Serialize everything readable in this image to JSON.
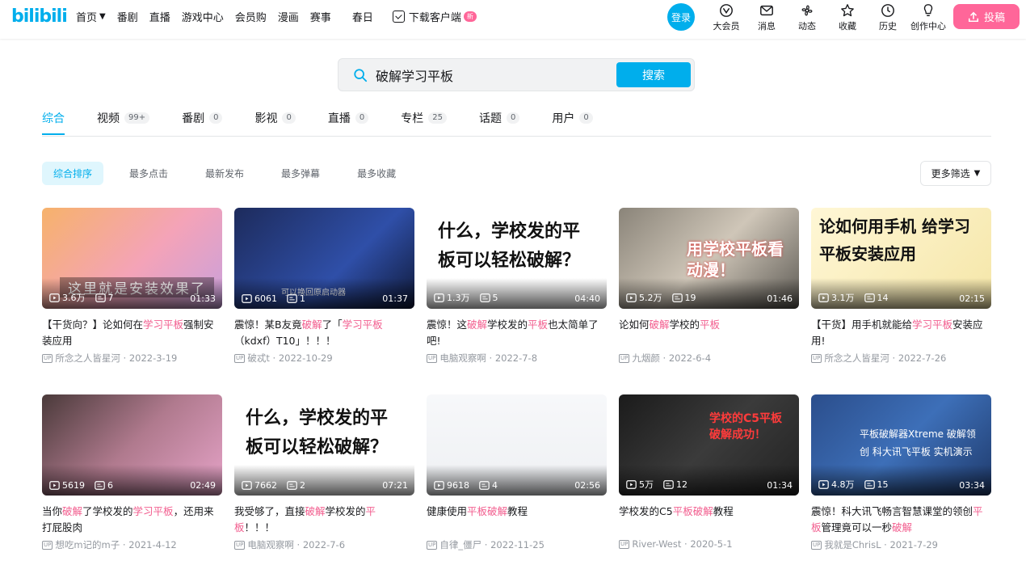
{
  "header": {
    "logo": "bilibili",
    "nav": [
      {
        "label": "首页",
        "chevron": true
      },
      {
        "label": "番剧"
      },
      {
        "label": "直播"
      },
      {
        "label": "游戏中心"
      },
      {
        "label": "会员购"
      },
      {
        "label": "漫画"
      },
      {
        "label": "赛事"
      },
      {
        "label": "春日"
      }
    ],
    "download": {
      "label": "下载客户端",
      "badge": "新"
    },
    "login": "登录",
    "right_items": [
      {
        "label": "大会员",
        "icon": "vip-icon"
      },
      {
        "label": "消息",
        "icon": "message-icon"
      },
      {
        "label": "动态",
        "icon": "dynamic-icon"
      },
      {
        "label": "收藏",
        "icon": "favorite-icon"
      },
      {
        "label": "历史",
        "icon": "history-icon"
      },
      {
        "label": "创作中心",
        "icon": "creator-icon"
      }
    ],
    "upload": "投稿"
  },
  "search": {
    "value": "破解学习平板",
    "button": "搜索"
  },
  "tabs": [
    {
      "label": "综合",
      "count": ""
    },
    {
      "label": "视频",
      "count": "99+"
    },
    {
      "label": "番剧",
      "count": "0"
    },
    {
      "label": "影视",
      "count": "0"
    },
    {
      "label": "直播",
      "count": "0"
    },
    {
      "label": "专栏",
      "count": "25"
    },
    {
      "label": "话题",
      "count": "0"
    },
    {
      "label": "用户",
      "count": "0"
    }
  ],
  "sorts": [
    "综合排序",
    "最多点击",
    "最新发布",
    "最多弹幕",
    "最多收藏"
  ],
  "more_filter": "更多筛选",
  "colors": {
    "accent": "#00aeec",
    "pink": "#ff6699",
    "highlight": "#f25d8e"
  },
  "cards": [
    {
      "views": "3.6万",
      "danmaku": "7",
      "duration": "01:33",
      "title": [
        {
          "t": "【干货向？】论如何在"
        },
        {
          "t": "学习平板",
          "hl": true
        },
        {
          "t": "强制安装应用"
        }
      ],
      "up": "所念之人皆星河",
      "date": "2022-3-19",
      "thumb_text": "这里就是安装效果了"
    },
    {
      "views": "6061",
      "danmaku": "1",
      "duration": "01:37",
      "title": [
        {
          "t": "震惊！某B友竟"
        },
        {
          "t": "破解",
          "hl": true
        },
        {
          "t": "了「"
        },
        {
          "t": "学习平板",
          "hl": true
        },
        {
          "t": "（kdxf）T10」！！！"
        }
      ],
      "up": "破忒t",
      "date": "2022-10-29",
      "thumb_text": "可以换回原启动器"
    },
    {
      "views": "1.3万",
      "danmaku": "5",
      "duration": "04:40",
      "title": [
        {
          "t": "震惊！这"
        },
        {
          "t": "破解",
          "hl": true
        },
        {
          "t": "学校发的"
        },
        {
          "t": "平板",
          "hl": true
        },
        {
          "t": "也太简单了吧!"
        }
      ],
      "up": "电脑观察啊",
      "date": "2022-7-8",
      "thumb_text": "什么，学校发的平板可以轻松破解？"
    },
    {
      "views": "5.2万",
      "danmaku": "19",
      "duration": "01:46",
      "title": [
        {
          "t": "论如何"
        },
        {
          "t": "破解",
          "hl": true
        },
        {
          "t": "学校的"
        },
        {
          "t": "平板",
          "hl": true
        }
      ],
      "up": "九烟颜",
      "date": "2022-6-4",
      "thumb_text": "用学校平板看动漫！"
    },
    {
      "views": "3.1万",
      "danmaku": "14",
      "duration": "02:15",
      "title": [
        {
          "t": "【干货】用手机就能给"
        },
        {
          "t": "学习平板",
          "hl": true
        },
        {
          "t": "安装应用!"
        }
      ],
      "up": "所念之人皆星河",
      "date": "2022-7-26",
      "thumb_text": "论如何用手机 给学习平板安装应用"
    },
    {
      "views": "5619",
      "danmaku": "6",
      "duration": "02:49",
      "title": [
        {
          "t": "当你"
        },
        {
          "t": "破解",
          "hl": true
        },
        {
          "t": "了学校发的"
        },
        {
          "t": "学习平板",
          "hl": true
        },
        {
          "t": "，还用来打屁股肉"
        }
      ],
      "up": "想吃m记的m子",
      "date": "2021-4-12",
      "thumb_text": ""
    },
    {
      "views": "7662",
      "danmaku": "2",
      "duration": "07:21",
      "title": [
        {
          "t": "我受够了，直接"
        },
        {
          "t": "破解",
          "hl": true
        },
        {
          "t": "学校发的"
        },
        {
          "t": "平板",
          "hl": true
        },
        {
          "t": "！！！"
        }
      ],
      "up": "电脑观察啊",
      "date": "2022-7-6",
      "thumb_text": "什么，学校发的平板可以轻松破解？"
    },
    {
      "views": "9618",
      "danmaku": "4",
      "duration": "02:56",
      "title": [
        {
          "t": "健康使用"
        },
        {
          "t": "平板",
          "hl": true
        },
        {
          "t": "破解",
          "hl": true
        },
        {
          "t": "教程"
        }
      ],
      "up": "自律_僵尸",
      "date": "2022-11-25",
      "thumb_text": ""
    },
    {
      "views": "5万",
      "danmaku": "12",
      "duration": "01:34",
      "title": [
        {
          "t": "学校发的C5"
        },
        {
          "t": "平板",
          "hl": true
        },
        {
          "t": "破解",
          "hl": true
        },
        {
          "t": "教程"
        }
      ],
      "up": "River-West",
      "date": "2020-5-1",
      "thumb_text": "学校的C5平板破解成功！"
    },
    {
      "views": "4.8万",
      "danmaku": "15",
      "duration": "03:34",
      "title": [
        {
          "t": "震惊！科大讯飞畅言智慧课堂的领创"
        },
        {
          "t": "平板",
          "hl": true
        },
        {
          "t": "管理竟可以一秒"
        },
        {
          "t": "破解",
          "hl": true
        }
      ],
      "up": "我就是ChrisL",
      "date": "2021-7-29",
      "thumb_text": "平板破解器Xtreme 破解领创 科大讯飞平板 实机演示"
    }
  ]
}
